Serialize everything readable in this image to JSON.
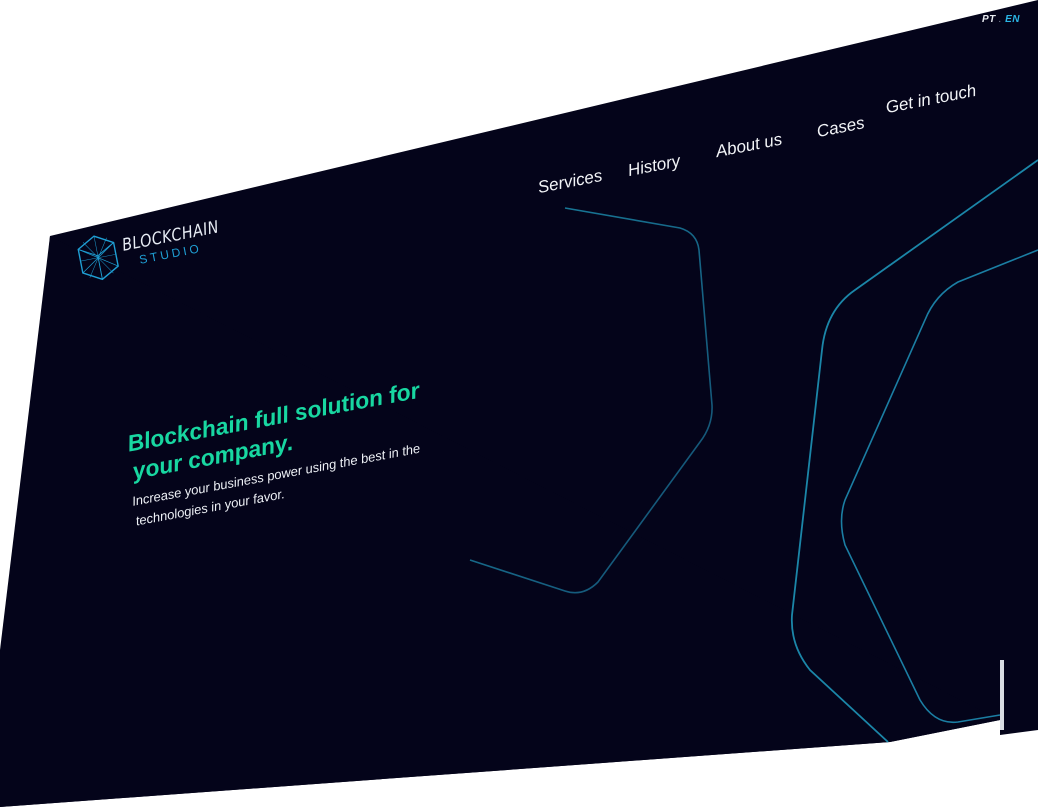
{
  "brand": {
    "title": "BLOCKCHAIN",
    "subtitle": "STUDIO"
  },
  "lang": {
    "pt": "PT",
    "separator": ".",
    "en": "EN",
    "active": "EN"
  },
  "nav": [
    {
      "label": "Services"
    },
    {
      "label": "History"
    },
    {
      "label": "About us"
    },
    {
      "label": "Cases"
    },
    {
      "label": "Get in touch"
    }
  ],
  "hero": {
    "title": "Blockchain full solution for your company.",
    "subtitle": "Increase your business power using the best in the technologies in your favor."
  },
  "colors": {
    "background": "#04041a",
    "accent_green": "#18d7a1",
    "accent_blue": "#1f9fd4",
    "line": "#1b8fae",
    "text": "#f2f4f7"
  },
  "icons": {
    "logo": "geometric-polyhedron-icon"
  }
}
